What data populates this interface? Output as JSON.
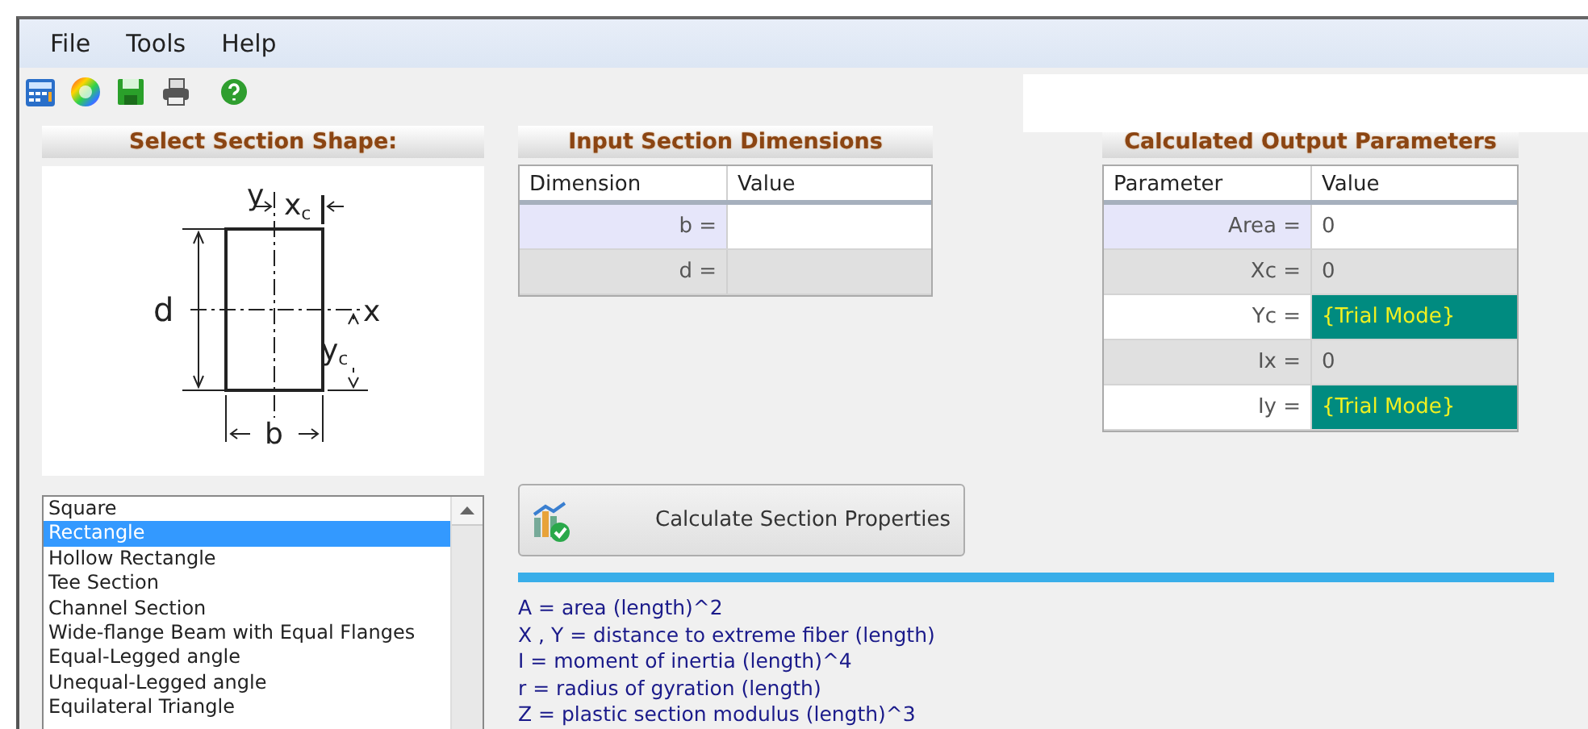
{
  "menu": [
    "File",
    "Tools",
    "Help"
  ],
  "toolbar": [
    {
      "kind": "calculator"
    },
    {
      "kind": "color-wheel"
    },
    {
      "kind": "save"
    },
    {
      "kind": "print"
    },
    {
      "kind": "help"
    }
  ],
  "shape_panel": {
    "title": "Select Section Shape:",
    "diagram_labels": {
      "y": "y",
      "xc": "x",
      "xc_sub": "c",
      "d": "d",
      "x": "x",
      "yc": "y",
      "yc_sub": "c",
      "b": "b"
    },
    "shapes": [
      {
        "label": "Square",
        "selected": false
      },
      {
        "label": "Rectangle",
        "selected": true
      },
      {
        "label": "Hollow Rectangle",
        "selected": false
      },
      {
        "label": "Tee Section",
        "selected": false
      },
      {
        "label": "Channel Section",
        "selected": false
      },
      {
        "label": "Wide-flange Beam with Equal Flanges",
        "selected": false
      },
      {
        "label": "Equal-Legged angle",
        "selected": false
      },
      {
        "label": "Unequal-Legged angle",
        "selected": false
      },
      {
        "label": "Equilateral Triangle",
        "selected": false
      }
    ]
  },
  "input_panel": {
    "title": "Input Section Dimensions",
    "columns": [
      "Dimension",
      "Value"
    ],
    "rows": [
      {
        "label": "b =",
        "value": "",
        "selected": true
      },
      {
        "label": "d =",
        "value": "",
        "selected": false
      }
    ]
  },
  "output_panel": {
    "title": "Calculated Output Parameters",
    "columns": [
      "Parameter",
      "Value"
    ],
    "rows": [
      {
        "label": "Area =",
        "value": "0",
        "selected": true,
        "trial": false
      },
      {
        "label": "Xc =",
        "value": "0",
        "selected": false,
        "trial": false
      },
      {
        "label": "Yc =",
        "value": "{Trial Mode}",
        "selected": false,
        "trial": true
      },
      {
        "label": "Ix =",
        "value": "0",
        "selected": false,
        "trial": false
      },
      {
        "label": "Iy =",
        "value": "{Trial Mode}",
        "selected": false,
        "trial": true
      }
    ]
  },
  "calculate_button": "Calculate Section Properties",
  "progress": {
    "level": 1
  },
  "legend": [
    "A = area (length)^2",
    "X , Y = distance to extreme fiber (length)",
    "I = moment of inertia (length)^4",
    "r = radius of gyration (length)",
    "Z = plastic section modulus (length)^3"
  ]
}
